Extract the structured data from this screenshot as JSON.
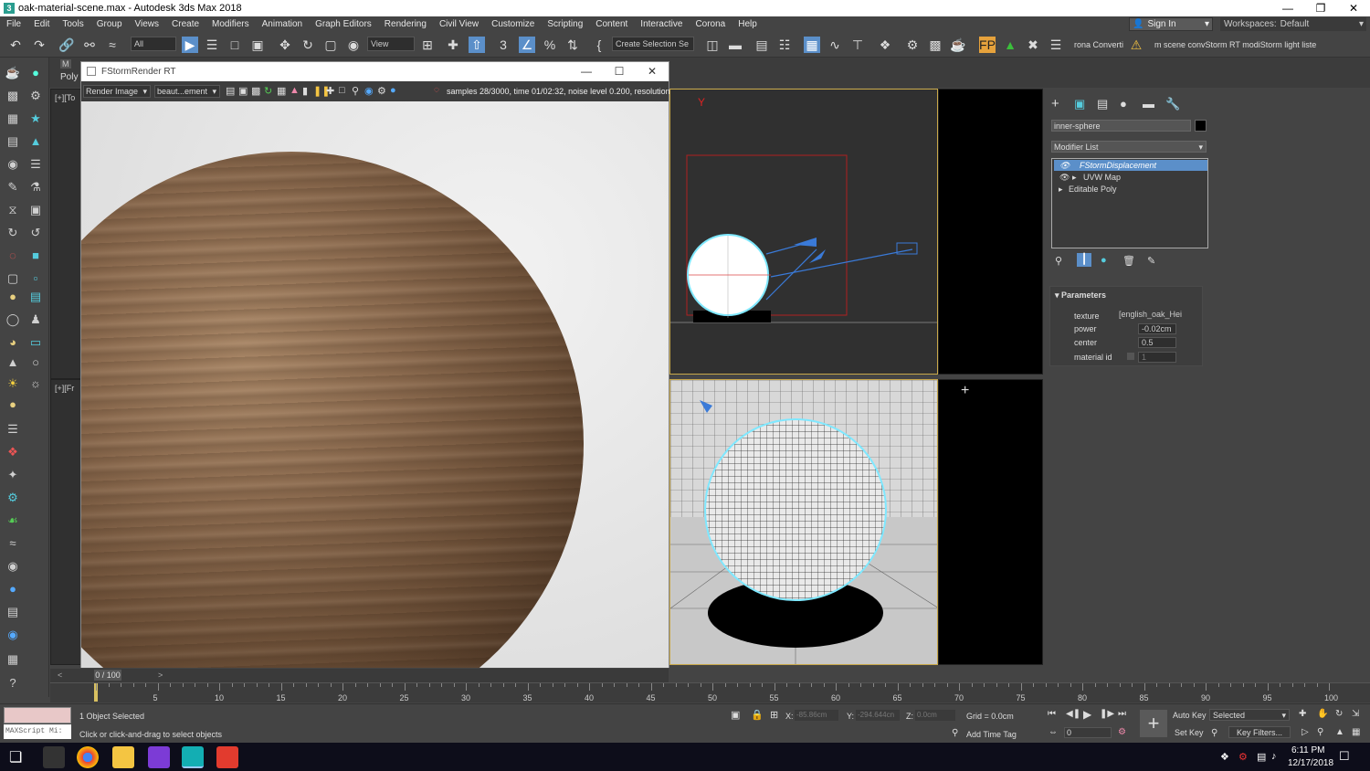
{
  "window": {
    "title": "oak-material-scene.max - Autodesk 3ds Max 2018",
    "app_icon": "3"
  },
  "menu": [
    "File",
    "Edit",
    "Tools",
    "Group",
    "Views",
    "Create",
    "Modifiers",
    "Animation",
    "Graph Editors",
    "Rendering",
    "Civil View",
    "Customize",
    "Scripting",
    "Content",
    "Interactive",
    "Corona",
    "Help"
  ],
  "account": {
    "sign_in": "Sign In",
    "workspaces_label": "Workspaces:",
    "workspace": "Default"
  },
  "toolbar": {
    "selection_filter": "All",
    "ref_coord": "View",
    "named_selection": "Create Selection Se",
    "corona_convert": "rona Converti",
    "scripts_text": "m scene convStorm RT modiStorm light liste"
  },
  "left_top_label": "Poly",
  "viewports": {
    "topleft_label": "[+][To",
    "bottomleft_label": "[+][Fr"
  },
  "render_window": {
    "title": "FStormRender RT",
    "channel": "Render Image",
    "element": "beaut...ement",
    "status": "samples 28/3000,  time 01/02:32,  noise level 0.200,  resolution"
  },
  "command_panel": {
    "object_name": "inner-sphere",
    "object_color": "#000000",
    "modifier_list": "Modifier List",
    "stack": [
      "FStormDisplacement",
      "UVW Map",
      "Editable Poly"
    ],
    "rollout": "Parameters",
    "params": [
      {
        "label": "texture",
        "value": "[english_oak_Hei"
      },
      {
        "label": "power",
        "value": "-0.02cm"
      },
      {
        "label": "center",
        "value": "0.5"
      },
      {
        "label": "material id",
        "value": "1"
      }
    ]
  },
  "time_slider": {
    "frame": "0 / 100",
    "ticks": [
      "5",
      "10",
      "15",
      "20",
      "25",
      "30",
      "35",
      "40",
      "45",
      "50",
      "55",
      "60",
      "65",
      "70",
      "75",
      "80",
      "85",
      "90",
      "95",
      "100"
    ]
  },
  "status_bar": {
    "maxscript": "MAXScript Mi:",
    "selected": "1 Object Selected",
    "prompt": "Click or click-and-drag to select objects",
    "x_label": "X:",
    "x_val": "-85.86cm",
    "y_label": "Y:",
    "y_val": "-294.644cn",
    "z_label": "Z:",
    "z_val": "0.0cm",
    "grid": "Grid = 0.0cm",
    "add_time_tag": "Add Time Tag",
    "auto_key": "Auto Key",
    "set_key": "Set Key",
    "key_mode": "Selected",
    "key_filters": "Key Filters...",
    "current_frame": "0"
  },
  "taskbar": {
    "time": "6:11 PM",
    "date": "12/17/2018"
  },
  "colors": {
    "accent": "#5b8fc9",
    "viewport_border": "#c8a84a",
    "selection_cyan": "#7fe8ff"
  }
}
